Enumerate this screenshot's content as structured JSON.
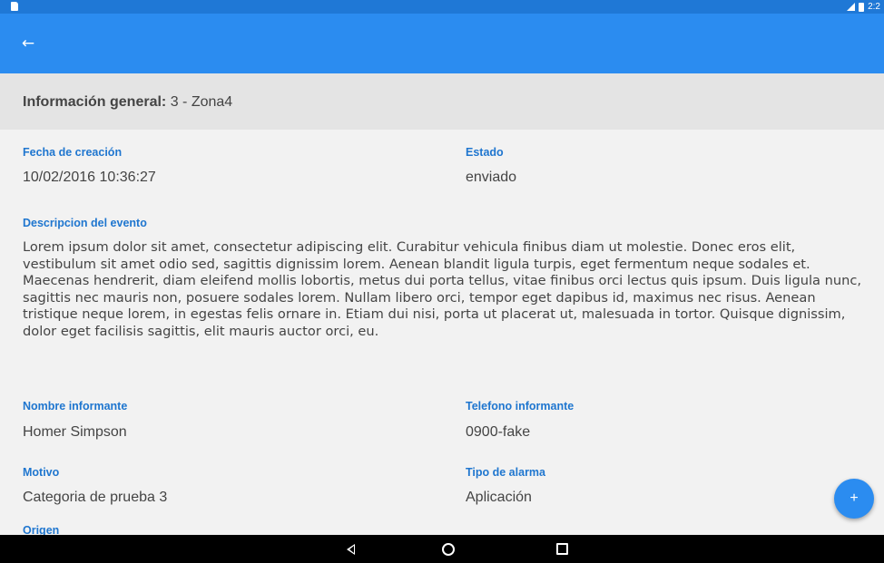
{
  "status_bar": {
    "time": "2:2"
  },
  "app_bar": {
    "back_icon": "arrow-left-icon",
    "back_glyph": "←"
  },
  "header": {
    "title_label": "Información general:",
    "title_value": " 3 - Zona4"
  },
  "fields": {
    "fecha_label": "Fecha de creación",
    "fecha_value": "10/02/2016 10:36:27",
    "estado_label": "Estado",
    "estado_value": "enviado",
    "descripcion_label": "Descripcion del evento",
    "descripcion_value": "Lorem ipsum dolor sit amet, consectetur adipiscing elit. Curabitur vehicula finibus diam ut molestie. Donec eros elit, vestibulum sit amet odio sed, sagittis dignissim lorem. Aenean blandit ligula turpis, eget fermentum neque sodales et. Maecenas hendrerit, diam eleifend mollis lobortis, metus dui porta tellus, vitae finibus orci lectus quis ipsum. Duis ligula nunc, sagittis nec mauris non, posuere sodales lorem. Nullam libero orci, tempor eget dapibus id, maximus nec risus. Aenean tristique neque lorem, in egestas felis ornare in. Etiam dui nisi, porta ut placerat ut, malesuada in tortor. Quisque dignissim, dolor eget facilisis sagittis, elit mauris auctor orci, eu.",
    "nombre_label": "Nombre informante",
    "nombre_value": "Homer Simpson",
    "telefono_label": "Telefono informante",
    "telefono_value": "0900-fake",
    "motivo_label": "Motivo",
    "motivo_value": "Categoria de prueba 3",
    "tipo_label": "Tipo de alarma",
    "tipo_value": "Aplicación",
    "origen_label": "Origen"
  },
  "fab": {
    "icon": "plus-icon",
    "glyph": "+"
  },
  "nav_bar": {
    "back_icon": "nav-back-icon",
    "home_icon": "nav-home-icon",
    "recents_icon": "nav-recents-icon"
  },
  "colors": {
    "primary": "#2b8cf0",
    "status_bar": "#1f78d6",
    "label_blue": "#1f76cf",
    "header_bg": "#e4e4e4",
    "text": "#444444"
  }
}
